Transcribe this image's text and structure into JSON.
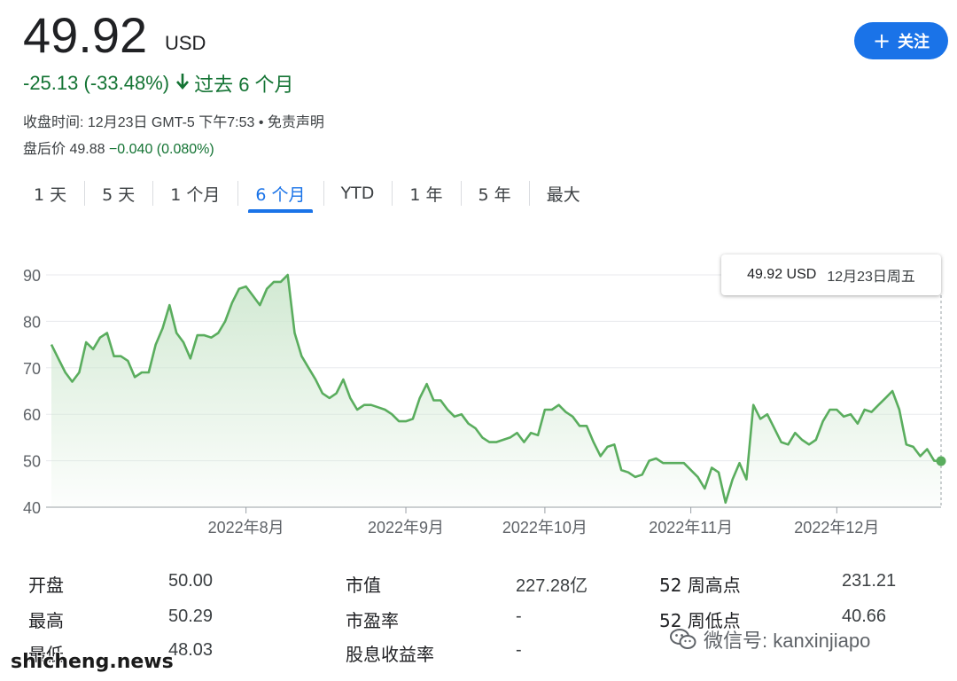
{
  "quote": {
    "price": "49.92",
    "currency": "USD",
    "change": "-25.13 (-33.48%)",
    "period_text": "过去 6 个月",
    "close_info": "收盘时间: 12月23日 GMT-5 下午7:53 • 免责声明",
    "after_label": "盘后价 49.88",
    "after_change": "−0.040 (0.080%)",
    "follow_label": "关注"
  },
  "tabs": [
    {
      "label": "1 天"
    },
    {
      "label": "5 天"
    },
    {
      "label": "1 个月"
    },
    {
      "label": "6 个月",
      "active": true
    },
    {
      "label": "YTD"
    },
    {
      "label": "1 年"
    },
    {
      "label": "5 年"
    },
    {
      "label": "最大"
    }
  ],
  "tooltip": {
    "value": "49.92 USD",
    "date": "12月23日周五"
  },
  "colors": {
    "line": "#5aad5e",
    "fill": "#cfe8d0",
    "accent": "#1a73e8",
    "positive": "#137333"
  },
  "chart_data": {
    "type": "area",
    "y_ticks": [
      "90",
      "80",
      "70",
      "60",
      "50",
      "40"
    ],
    "ylim": [
      40,
      90
    ],
    "x_ticks": [
      {
        "label": "2022年8月",
        "at": 28
      },
      {
        "label": "2022年9月",
        "at": 51
      },
      {
        "label": "2022年10月",
        "at": 71
      },
      {
        "label": "2022年11月",
        "at": 92
      },
      {
        "label": "2022年12月",
        "at": 113
      }
    ],
    "values": [
      75,
      72,
      69,
      67,
      69,
      75.5,
      74,
      76.5,
      77.5,
      72.5,
      72.5,
      71.5,
      68,
      69,
      69,
      75,
      78.5,
      83.5,
      77.5,
      75.5,
      72,
      77,
      77,
      76.5,
      77.5,
      80,
      84,
      87,
      87.5,
      85.5,
      83.5,
      87,
      88.5,
      88.5,
      90,
      77.5,
      72.5,
      70,
      67.5,
      64.5,
      63.5,
      64.5,
      67.5,
      63.5,
      61,
      62,
      62,
      61.5,
      61,
      60,
      58.5,
      58.5,
      59,
      63.5,
      66.5,
      63,
      63,
      61,
      59.5,
      60,
      58,
      57,
      55,
      54,
      54,
      54.5,
      55,
      56,
      54,
      56,
      55.5,
      61,
      61,
      62,
      60.5,
      59.5,
      57.5,
      57.5,
      54,
      51,
      53,
      53.5,
      48,
      47.5,
      46.5,
      47,
      50,
      50.5,
      49.5,
      49.5,
      49.5,
      49.5,
      48,
      46.5,
      44,
      48.5,
      47.5,
      41,
      46,
      49.5,
      46,
      62,
      59,
      60,
      57,
      54,
      53.5,
      56,
      54.5,
      53.5,
      54.5,
      58.5,
      61,
      61,
      59.5,
      60,
      58,
      61,
      60.5,
      62,
      63.5,
      65,
      61,
      53.5,
      53,
      51,
      52.5,
      50,
      49.92
    ],
    "grid": true,
    "last_point_marker": true
  },
  "stats": [
    {
      "label": "开盘",
      "value": "50.00"
    },
    {
      "label": "最高",
      "value": "50.29"
    },
    {
      "label": "最低",
      "value": "48.03"
    },
    {
      "label": "市值",
      "value": "227.28亿"
    },
    {
      "label": "市盈率",
      "value": "-"
    },
    {
      "label": "股息收益率",
      "value": "-"
    },
    {
      "label": "52 周高点",
      "value": "231.21"
    },
    {
      "label": "52 周低点",
      "value": "40.66"
    }
  ],
  "watermark": {
    "text": "微信号: kanxinjiapo",
    "icon": "wechat-icon"
  },
  "site_watermark": "shicheng.news"
}
